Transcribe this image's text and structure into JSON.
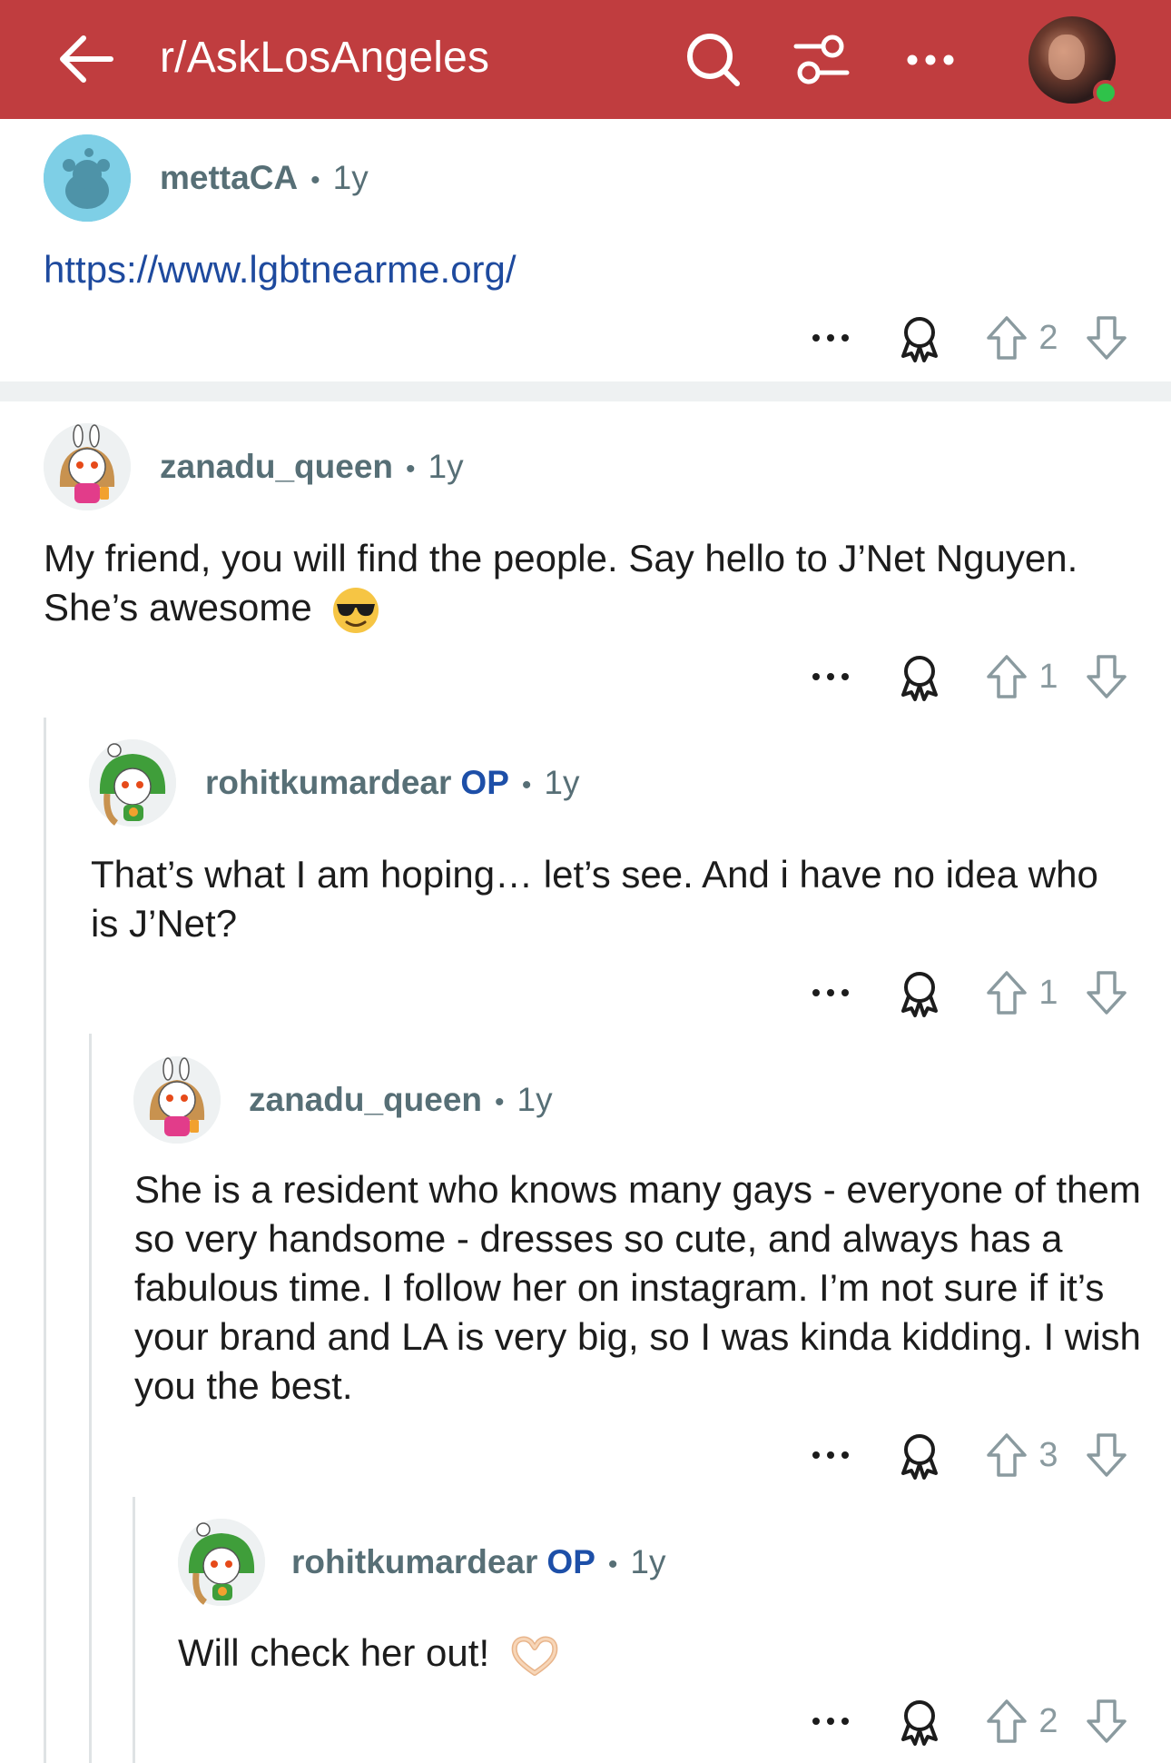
{
  "header": {
    "title": "r/AskLosAngeles",
    "back_icon": "back-arrow-icon",
    "search_icon": "search-icon",
    "filter_icon": "filter-sliders-icon",
    "more_icon": "more-horizontal-icon",
    "avatar": "user-avatar",
    "bg_color": "#c03d3f"
  },
  "comments": [
    {
      "user": "mettaCA",
      "op": "",
      "age": "1y",
      "text": "https://www.lgbtnearme.org/",
      "votes": "2"
    },
    {
      "user": "zanadu_queen",
      "op": "",
      "age": "1y",
      "text": "My friend, you will find the people. Say hello to J’Net Nguyen. She’s awesome",
      "votes": "1"
    },
    {
      "user": "rohitkumardear",
      "op": "OP",
      "age": "1y",
      "text": "That’s what I am hoping… let’s see. And i have no idea who is J’Net?",
      "votes": "1"
    },
    {
      "user": "zanadu_queen",
      "op": "",
      "age": "1y",
      "text": "She is a resident who knows many gays - everyone of them so very handsome -  dresses so cute, and always has a fabulous time. I follow her on instagram. I’m not sure if it’s your brand and LA is very big, so I was kinda kidding. I wish you the best.",
      "votes": "3"
    },
    {
      "user": "rohitkumardear",
      "op": "OP",
      "age": "1y",
      "text": "Will check her out!",
      "votes": "2"
    }
  ],
  "meta_separator": "•",
  "emojis": {
    "sunglasses": "sunglasses-emoji",
    "heart_hands": "heart-hands-emoji"
  }
}
